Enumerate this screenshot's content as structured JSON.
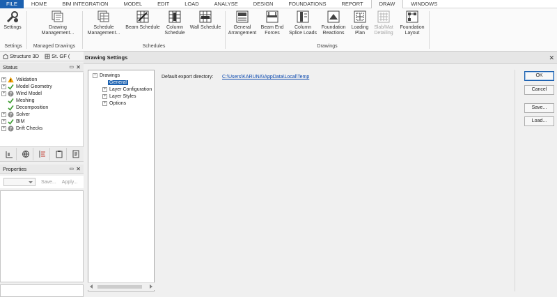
{
  "menu": {
    "tabs": [
      "FILE",
      "HOME",
      "BIM INTEGRATION",
      "MODEL",
      "EDIT",
      "LOAD",
      "ANALYSE",
      "DESIGN",
      "FOUNDATIONS",
      "REPORT",
      "DRAW",
      "WINDOWS"
    ],
    "active": "DRAW"
  },
  "ribbon": {
    "settings": "Settings",
    "drawing_management": "Drawing Management...",
    "schedule_management": "Schedule Management...",
    "beam_schedule": "Beam Schedule",
    "column_schedule": "Column Schedule",
    "wall_schedule": "Wall Schedule",
    "general_arrangement": "General Arrangement",
    "beam_end_forces": "Beam End Forces",
    "column_splice_loads": "Column Splice Loads",
    "foundation_reactions": "Foundation Reactions",
    "loading_plan": "Loading Plan",
    "slab_mat_detailing": "Slab/Mat Detailing",
    "foundation_layout": "Foundation Layout",
    "groups": {
      "settings": "Settings",
      "managed_drawings": "Managed Drawings",
      "schedules": "Schedules",
      "drawings": "Drawings"
    }
  },
  "viewtabs": [
    "Structure 3D",
    "St. GF ("
  ],
  "status_panel": {
    "title": "Status",
    "items": [
      {
        "label": "Validation",
        "state": "warning",
        "expandable": true
      },
      {
        "label": "Model Geometry",
        "state": "ok",
        "expandable": true
      },
      {
        "label": "Wind Model",
        "state": "unknown",
        "expandable": true
      },
      {
        "label": "Meshing",
        "state": "ok",
        "expandable": false
      },
      {
        "label": "Decomposition",
        "state": "ok",
        "expandable": false
      },
      {
        "label": "Solver",
        "state": "unknown",
        "expandable": true
      },
      {
        "label": "BIM",
        "state": "ok",
        "expandable": true
      },
      {
        "label": "Drift Checks",
        "state": "unknown",
        "expandable": true
      }
    ]
  },
  "properties_panel": {
    "title": "Properties",
    "save": "Save...",
    "apply": "Apply..."
  },
  "dialog": {
    "title": "Drawing Settings",
    "tree": {
      "root": "Drawings",
      "selected": "General",
      "children": [
        "Layer Configuration",
        "Layer Styles",
        "Options"
      ]
    },
    "export_label": "Default export directory:",
    "export_path": "C:\\Users\\KARUNA\\AppData\\Local\\Temp",
    "buttons": {
      "ok": "OK",
      "cancel": "Cancel",
      "save": "Save...",
      "load": "Load..."
    }
  },
  "colors": {
    "accent": "#1c61b0",
    "ok": "#3a9b2e",
    "warning": "#f2a100",
    "link": "#0645ad"
  }
}
